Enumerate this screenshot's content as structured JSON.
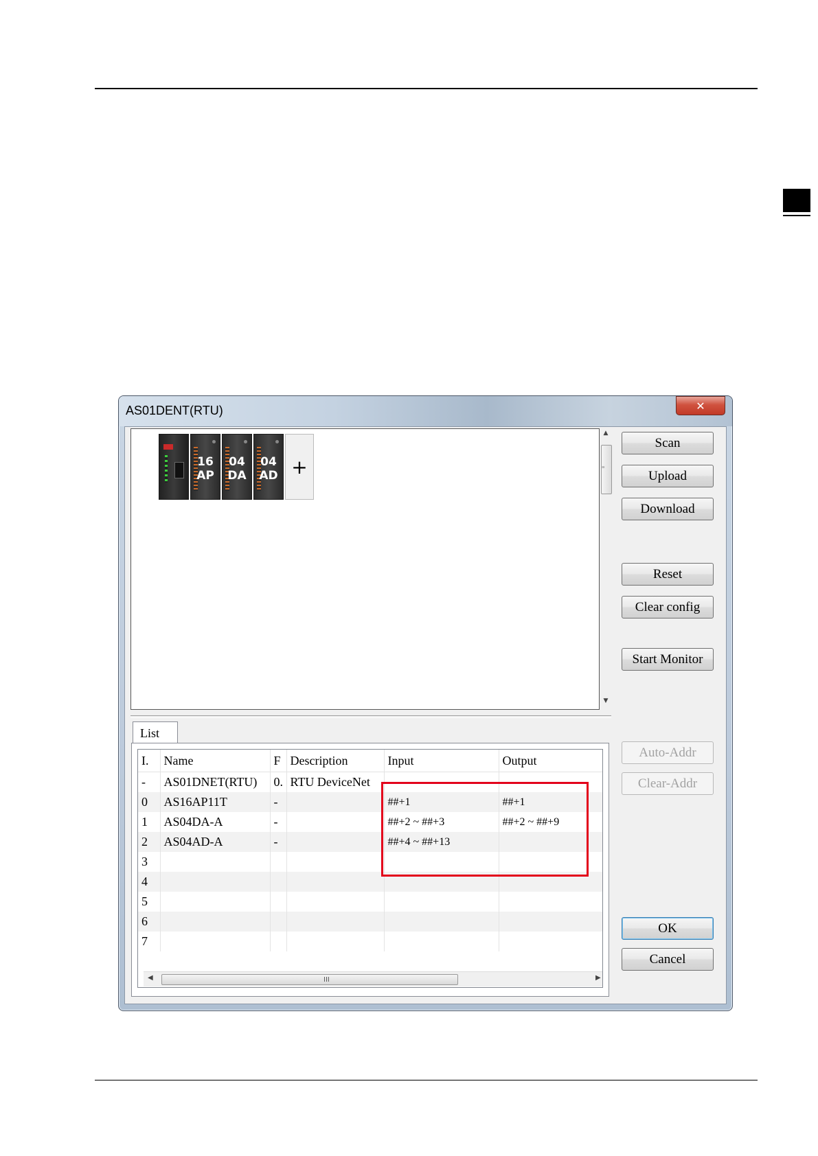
{
  "window": {
    "title": "AS01DENT(RTU)",
    "close_glyph": "✕"
  },
  "rack": {
    "modules": [
      {
        "line1": "",
        "line2": ""
      },
      {
        "line1": "16",
        "line2": "AP"
      },
      {
        "line1": "04",
        "line2": "DA"
      },
      {
        "line1": "04",
        "line2": "AD"
      }
    ],
    "add_label": "+"
  },
  "buttons": {
    "scan": "Scan",
    "upload": "Upload",
    "download": "Download",
    "reset": "Reset",
    "clear_config": "Clear config",
    "start_monitor": "Start Monitor",
    "auto_addr": "Auto-Addr",
    "clear_addr": "Clear-Addr",
    "ok": "OK",
    "cancel": "Cancel"
  },
  "list": {
    "tab_label": "List",
    "columns": [
      "I.",
      "Name",
      "F",
      "Description",
      "Input",
      "Output"
    ],
    "rows": [
      [
        "-",
        "AS01DNET(RTU)",
        "0.",
        "RTU DeviceNet",
        "",
        ""
      ],
      [
        "0",
        "AS16AP11T",
        "-",
        "",
        "##+1",
        "##+1"
      ],
      [
        "1",
        "AS04DA-A",
        "-",
        "",
        "##+2 ~ ##+3",
        "##+2 ~ ##+9"
      ],
      [
        "2",
        "AS04AD-A",
        "-",
        "",
        "##+4 ~ ##+13",
        ""
      ],
      [
        "3",
        "",
        "",
        "",
        "",
        ""
      ],
      [
        "4",
        "",
        "",
        "",
        "",
        ""
      ],
      [
        "5",
        "",
        "",
        "",
        "",
        ""
      ],
      [
        "6",
        "",
        "",
        "",
        "",
        ""
      ],
      [
        "7",
        "",
        "",
        "",
        "",
        ""
      ]
    ],
    "hscroll_grip": "III"
  },
  "colors": {
    "highlight": "#e3001b",
    "window_frame": "#bccadb"
  }
}
